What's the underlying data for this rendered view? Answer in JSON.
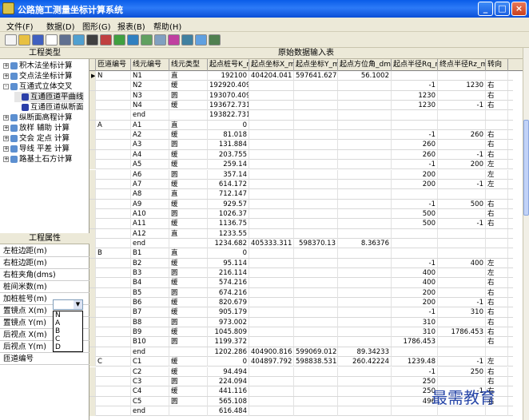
{
  "window": {
    "title": "公路施工测量坐标计算系统"
  },
  "menu": [
    "文件(F)",
    "数据(D)",
    "图形(G)",
    "报表(B)",
    "帮助(H)"
  ],
  "toolbar_icons": [
    "new-file-icon",
    "open-folder-icon",
    "save-icon",
    "document-icon",
    "print-icon",
    "mail-icon",
    "pen-icon",
    "chart-icon",
    "table-icon",
    "image-icon",
    "grid-icon",
    "copy-icon",
    "eraser-icon",
    "settings-icon",
    "globe-icon",
    "export-icon"
  ],
  "left": {
    "tree_header": "工程类型",
    "tree": [
      {
        "pm": "+",
        "label": "积木法坐标计算",
        "indent": 0,
        "icon": "folder-icon"
      },
      {
        "pm": "+",
        "label": "交点法坐标计算",
        "indent": 0,
        "icon": "folder-icon"
      },
      {
        "pm": "-",
        "label": "互通式立体交叉",
        "indent": 0,
        "icon": "folder-icon"
      },
      {
        "pm": "",
        "label": "互通匝道平曲线",
        "indent": 1,
        "icon": "document-icon"
      },
      {
        "pm": "",
        "label": "互通匝道纵断面",
        "indent": 1,
        "icon": "document-icon"
      },
      {
        "pm": "+",
        "label": "纵断面高程计算",
        "indent": 0,
        "icon": "folder-icon"
      },
      {
        "pm": "+",
        "label": "放样 辅助 计算",
        "indent": 0,
        "icon": "folder-icon"
      },
      {
        "pm": "+",
        "label": "交会 定点 计算",
        "indent": 0,
        "icon": "folder-icon"
      },
      {
        "pm": "+",
        "label": "导线 平差 计算",
        "indent": 0,
        "icon": "folder-icon"
      },
      {
        "pm": "+",
        "label": "路基土石方计算",
        "indent": 0,
        "icon": "folder-icon"
      }
    ],
    "props_header": "工程属性",
    "props": [
      "左桩边距(m)",
      "右桩边距(m)",
      "右桩夹角(dms)",
      "桩间米数(m)",
      "加桩桩号(m)",
      "置镜点 X(m)",
      "置镜点 Y(m)",
      "后视点 X(m)",
      "后视点 Y(m)",
      "匝道编号"
    ],
    "dropdown_options": [
      "N",
      "A",
      "B",
      "C",
      "D"
    ]
  },
  "grid": {
    "title": "原始数据输入表",
    "columns": [
      "匝道编号",
      "线元编号",
      "线元类型",
      "起点桩号K_m",
      "起点坐标X_m",
      "起点坐标Y_m",
      "起点方位角_dms",
      "起点半径Rq_m",
      "终点半径Rz_m",
      "转向"
    ],
    "rows": [
      [
        "N",
        "N1",
        "直",
        "192100",
        "404204.041",
        "597641.627",
        "56.1002",
        "",
        "",
        ""
      ],
      [
        "",
        "N2",
        "缓",
        "192920.409",
        "",
        "",
        "",
        "-1",
        "1230",
        "右"
      ],
      [
        "",
        "N3",
        "圆",
        "193070.409",
        "",
        "",
        "",
        "1230",
        "",
        "右"
      ],
      [
        "",
        "N4",
        "缓",
        "193672.731",
        "",
        "",
        "",
        "1230",
        "-1",
        "右"
      ],
      [
        "",
        "end",
        "",
        "193822.731",
        "",
        "",
        "",
        "",
        "",
        ""
      ],
      [
        "A",
        "A1",
        "直",
        "0",
        "",
        "",
        "",
        "",
        "",
        ""
      ],
      [
        "",
        "A2",
        "缓",
        "81.018",
        "",
        "",
        "",
        "-1",
        "260",
        "右"
      ],
      [
        "",
        "A3",
        "圆",
        "131.884",
        "",
        "",
        "",
        "260",
        "",
        "右"
      ],
      [
        "",
        "A4",
        "缓",
        "203.755",
        "",
        "",
        "",
        "260",
        "-1",
        "右"
      ],
      [
        "",
        "A5",
        "缓",
        "259.14",
        "",
        "",
        "",
        "-1",
        "200",
        "左"
      ],
      [
        "",
        "A6",
        "圆",
        "357.14",
        "",
        "",
        "",
        "200",
        "",
        "左"
      ],
      [
        "",
        "A7",
        "缓",
        "614.172",
        "",
        "",
        "",
        "200",
        "-1",
        "左"
      ],
      [
        "",
        "A8",
        "直",
        "712.147",
        "",
        "",
        "",
        "",
        "",
        ""
      ],
      [
        "",
        "A9",
        "缓",
        "929.57",
        "",
        "",
        "",
        "-1",
        "500",
        "右"
      ],
      [
        "",
        "A10",
        "圆",
        "1026.37",
        "",
        "",
        "",
        "500",
        "",
        "右"
      ],
      [
        "",
        "A11",
        "缓",
        "1136.75",
        "",
        "",
        "",
        "500",
        "-1",
        "右"
      ],
      [
        "",
        "A12",
        "直",
        "1233.55",
        "",
        "",
        "",
        "",
        "",
        ""
      ],
      [
        "",
        "end",
        "",
        "1234.682",
        "405333.311",
        "598370.13",
        "8.36376",
        "",
        "",
        ""
      ],
      [
        "B",
        "B1",
        "直",
        "0",
        "",
        "",
        "",
        "",
        "",
        ""
      ],
      [
        "",
        "B2",
        "缓",
        "95.114",
        "",
        "",
        "",
        "-1",
        "400",
        "左"
      ],
      [
        "",
        "B3",
        "圆",
        "216.114",
        "",
        "",
        "",
        "400",
        "",
        "左"
      ],
      [
        "",
        "B4",
        "缓",
        "574.216",
        "",
        "",
        "",
        "400",
        "",
        "右"
      ],
      [
        "",
        "B5",
        "圆",
        "674.216",
        "",
        "",
        "",
        "200",
        "",
        "右"
      ],
      [
        "",
        "B6",
        "缓",
        "820.679",
        "",
        "",
        "",
        "200",
        "-1",
        "右"
      ],
      [
        "",
        "B7",
        "缓",
        "905.179",
        "",
        "",
        "",
        "-1",
        "310",
        "右"
      ],
      [
        "",
        "B8",
        "圆",
        "973.002",
        "",
        "",
        "",
        "310",
        "",
        "右"
      ],
      [
        "",
        "B9",
        "缓",
        "1045.809",
        "",
        "",
        "",
        "310",
        "1786.453",
        "右"
      ],
      [
        "",
        "B10",
        "圆",
        "1199.372",
        "",
        "",
        "",
        "1786.453",
        "",
        "右"
      ],
      [
        "",
        "end",
        "",
        "1202.286",
        "404900.816",
        "599069.012",
        "89.34233",
        "",
        "",
        ""
      ],
      [
        "C",
        "C1",
        "缓",
        "0",
        "404897.792",
        "598838.531",
        "260.42224",
        "1239.48",
        "-1",
        "左"
      ],
      [
        "",
        "C2",
        "缓",
        "94.494",
        "",
        "",
        "",
        "-1",
        "250",
        "右"
      ],
      [
        "",
        "C3",
        "圆",
        "224.094",
        "",
        "",
        "",
        "250",
        "",
        "右"
      ],
      [
        "",
        "C4",
        "缓",
        "441.116",
        "",
        "",
        "",
        "250",
        "-1",
        "右"
      ],
      [
        "",
        "C5",
        "圆",
        "565.108",
        "",
        "",
        "",
        "496",
        "",
        "右"
      ],
      [
        "",
        "end",
        "",
        "616.484",
        "",
        "",
        "",
        "",
        "",
        ""
      ]
    ]
  },
  "watermark": "最需教育"
}
